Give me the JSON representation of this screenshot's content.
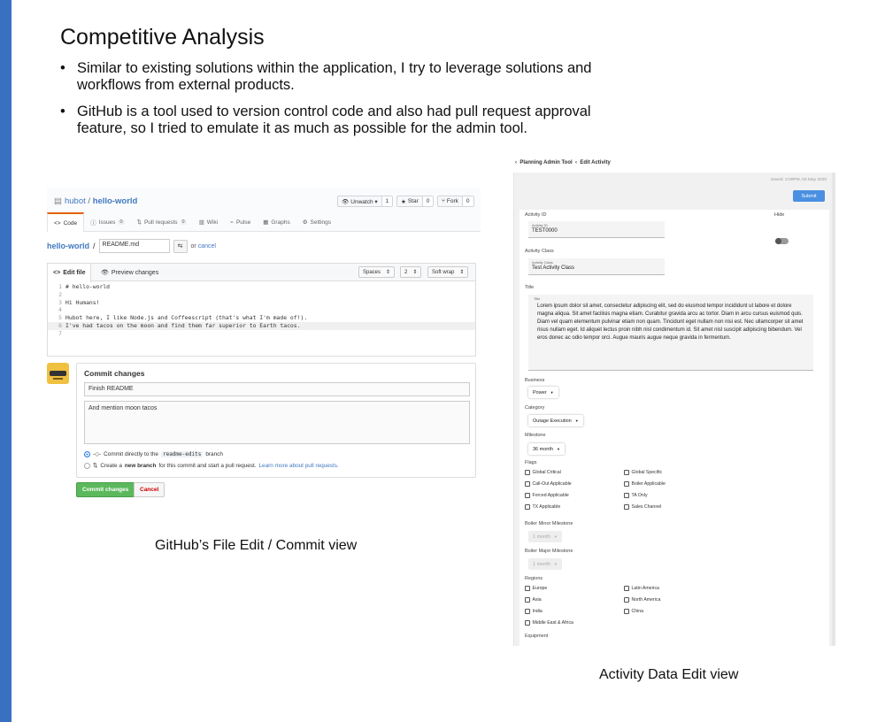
{
  "slide": {
    "title": "Competitive Analysis",
    "bullets": [
      "Similar to existing solutions within the application, I try to leverage solutions and workflows from external products.",
      "GitHub is a tool used to version control code and also had pull request approval feature, so I tried to emulate it as much as possible for the admin tool."
    ],
    "caption_github": "GitHub’s File Edit / Commit view",
    "caption_activity": "Activity Data Edit view",
    "accent_color": "#3a70c0"
  },
  "github": {
    "repo_owner": "hubot",
    "repo_name": "hello-world",
    "unwatch_label": "Unwatch ▾",
    "unwatch_count": "1",
    "star_label": "Star",
    "star_count": "0",
    "fork_label": "Fork",
    "fork_count": "0",
    "tabs": [
      {
        "label": "Code",
        "icon": "code-icon",
        "count": ""
      },
      {
        "label": "Issues",
        "icon": "issue-icon",
        "count": "0"
      },
      {
        "label": "Pull requests",
        "icon": "pull-request-icon",
        "count": "0"
      },
      {
        "label": "Wiki",
        "icon": "book-icon",
        "count": ""
      },
      {
        "label": "Pulse",
        "icon": "pulse-icon",
        "count": ""
      },
      {
        "label": "Graphs",
        "icon": "graph-icon",
        "count": ""
      },
      {
        "label": "Settings",
        "icon": "gear-icon",
        "count": ""
      }
    ],
    "path_repo": "hello-world",
    "path_sep": "/",
    "file_name": "README.md",
    "or_text": "or",
    "cancel_link": "cancel",
    "edit_tab": "Edit file",
    "preview_tab": "Preview changes",
    "indent_mode": "Spaces",
    "indent_size": "2",
    "wrap_mode": "Soft wrap",
    "code_lines": [
      {
        "no": "1",
        "text": "# hello-world"
      },
      {
        "no": "2",
        "text": ""
      },
      {
        "no": "3",
        "text": "Hi Humans!"
      },
      {
        "no": "4",
        "text": ""
      },
      {
        "no": "5",
        "text": "Hubot here, I like Node.js and Coffeescript (that's what I'm made of!)."
      },
      {
        "no": "6",
        "text": "I've had tacos on the moon and find them far superior to Earth tacos."
      },
      {
        "no": "7",
        "text": ""
      }
    ],
    "commit_title": "Commit changes",
    "commit_summary": "Finish README",
    "commit_description": "And mention moon tacos",
    "option1_prefix": "Commit directly to the",
    "option1_branch": "readme-edits",
    "option1_suffix": "branch",
    "option2_prefix": "Create a",
    "option2_bold": "new branch",
    "option2_suffix": "for this commit and start a pull request.",
    "option2_link": "Learn more about pull requests.",
    "commit_button": "Commit changes",
    "cancel_button": "Cancel"
  },
  "activity": {
    "breadcrumb_parent": "Planning Admin Tool",
    "breadcrumb_current": "Edit Activity",
    "saved_text": "Saved: 2:00PM, 03 May 2020",
    "submit_label": "Submit",
    "activity_id_label": "Activity ID",
    "activity_id_small": "Activity ID",
    "activity_id_value": "TEST0000",
    "hide_label": "Hide",
    "activity_class_label": "Activity Class",
    "activity_class_small": "Activity Class",
    "activity_class_value": "Test Activity Class",
    "title_label": "Title",
    "title_small": "Title",
    "title_value": "Lorem ipsum dolor sit amet, consectetur adipiscing elit, sed do eiusmod tempor incididunt ut labore et dolore magna aliqua. Sit amet facilisis magna etiam. Curabitur gravida arcu ac tortor. Diam in arcu cursus euismod quis. Diam vel quam elementum pulvinar etiam non quam. Tincidunt eget nullam non nisi est. Nec ullamcorper sit amet risus nullam eget. Id aliquet lectus proin nibh nisl condimentum id. Sit amet nisl suscipit adipiscing bibendum. Vel eros donec ac odio tempor orci. Augue mauris augue neque gravida in fermentum.",
    "business_label": "Business",
    "business_value": "Power",
    "category_label": "Category",
    "category_value": "Outage Execution",
    "milestone_label": "Milestone",
    "milestone_value": "36 month",
    "flags_label": "Flags",
    "flags": [
      "Global Critical",
      "Global Specific",
      "Call-Out Applicable",
      "Boiler Applicable",
      "Forced Applicable",
      "TA Only",
      "TX Applicable",
      "Sales Channel"
    ],
    "boiler_minor_label": "Boiler Minor Milestone",
    "boiler_minor_value": "1 month",
    "boiler_major_label": "Boiler Major Milestone",
    "boiler_major_value": "1 month",
    "regions_label": "Regions",
    "regions": [
      "Europe",
      "Latin America",
      "Asia",
      "North America",
      "India",
      "China",
      "Middle East & Africa"
    ],
    "equipment_label": "Equipment"
  }
}
